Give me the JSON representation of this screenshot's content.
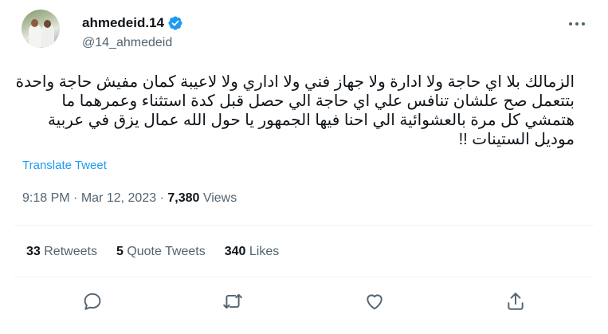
{
  "author": {
    "display_name": "ahmedeid.14",
    "handle": "@14_ahmedeid",
    "verified": true,
    "avatar_icon": "profile-photo"
  },
  "tweet": {
    "text_lines": [
      "الزمالك بلا اي حاجة ولا ادارة ولا جهاز فني ولا اداري ولا لاعيبة كمان مفيش حاجة واحدة",
      "بتتعمل صح علشان تنافس علي اي حاجة الي حصل قبل كدة استثناء وعمرهما ما",
      "هتمشي كل مرة بالعشوائية الي احنا فيها الجمهور يا حول الله عمال يزق في عربية",
      "موديل الستينات !!"
    ],
    "translate_label": "Translate Tweet",
    "time": "9:18 PM",
    "separator": "·",
    "date": "Mar 12, 2023",
    "views_count": "7,380",
    "views_label": "Views"
  },
  "stats": {
    "retweets_count": "33",
    "retweets_label": "Retweets",
    "quotes_count": "5",
    "quotes_label": "Quote Tweets",
    "likes_count": "340",
    "likes_label": "Likes"
  },
  "colors": {
    "accent": "#1d9bf0",
    "text_primary": "#0f1419",
    "text_secondary": "#536471",
    "divider": "#eff3f4"
  },
  "icons": {
    "verified": "verified-badge-icon",
    "more": "more-dots-icon",
    "reply": "reply-icon",
    "retweet": "retweet-icon",
    "like": "heart-icon",
    "share": "share-icon"
  }
}
